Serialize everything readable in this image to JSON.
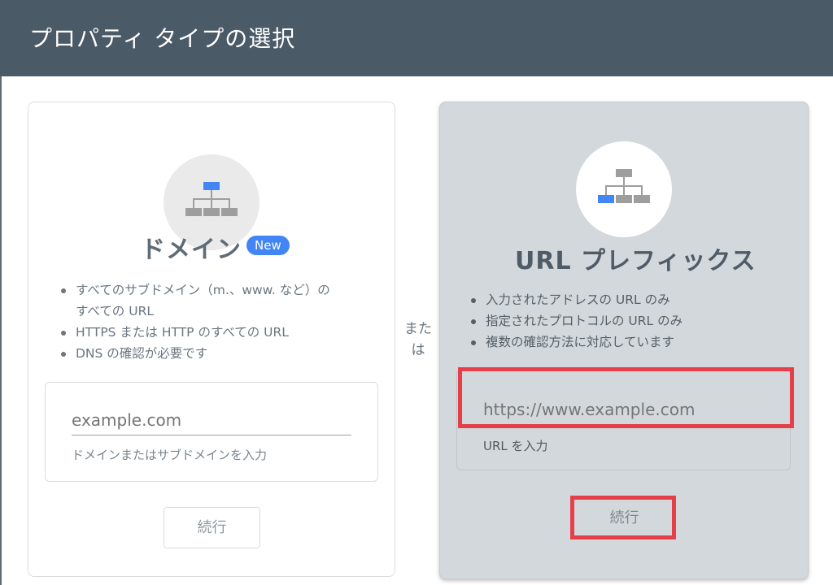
{
  "header": {
    "title": "プロパティ タイプの選択"
  },
  "domain_card": {
    "title": "ドメイン",
    "badge": "New",
    "bullets": [
      "すべてのサブドメイン（m.、www. など）の\nすべての URL",
      "HTTPS または HTTP のすべての URL",
      "DNS の確認が必要です"
    ],
    "input_placeholder": "example.com",
    "input_value": "",
    "helper_text": "ドメインまたはサブドメインを入力",
    "button_label": "続行",
    "icon": "sitemap-icon"
  },
  "or_label": "また\nは",
  "url_card": {
    "title": "URL プレフィックス",
    "bullets": [
      "入力されたアドレスの URL のみ",
      "指定されたプロトコルの URL のみ",
      "複数の確認方法に対応しています"
    ],
    "input_placeholder": "https://www.example.com",
    "input_value": "",
    "helper_text": "URL を入力",
    "button_label": "続行",
    "icon": "sitemap-icon"
  },
  "colors": {
    "header_bg": "#4a5a66",
    "accent_blue": "#4285f4",
    "highlight_red": "#e5404a",
    "selected_card_bg": "#d3d8dc"
  }
}
